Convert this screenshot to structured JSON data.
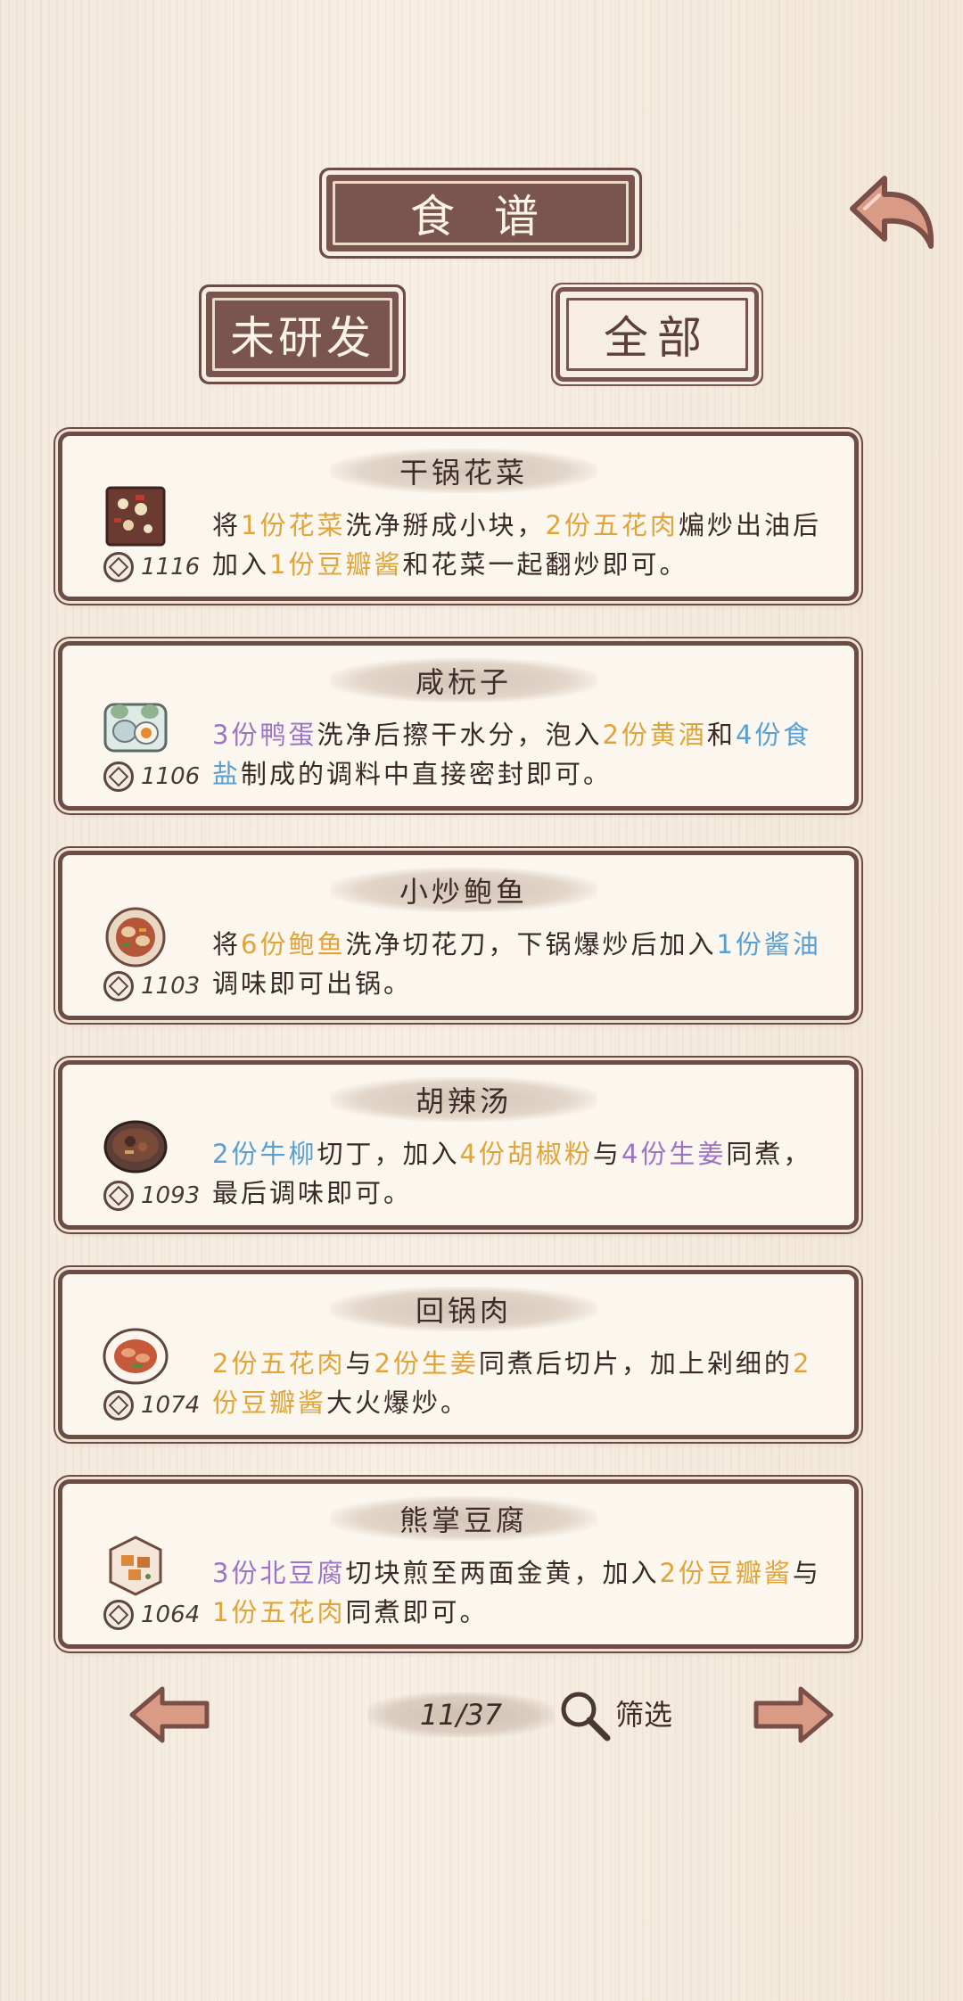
{
  "header": {
    "title": "食 谱",
    "tab_undeveloped": "未研发",
    "tab_all": "全部"
  },
  "recipes": [
    {
      "name": "干锅花菜",
      "price": "1116",
      "dish_icon": "dry-pot-cauliflower-dish-icon",
      "desc": [
        {
          "t": "将",
          "c": ""
        },
        {
          "t": "1份花菜",
          "c": "y"
        },
        {
          "t": "洗净掰成小块，",
          "c": ""
        },
        {
          "t": "2份五花肉",
          "c": "y"
        },
        {
          "t": "煸炒出油后加入",
          "c": ""
        },
        {
          "t": "1份豆瓣酱",
          "c": "y"
        },
        {
          "t": "和花菜一起翻炒即可。",
          "c": ""
        }
      ]
    },
    {
      "name": "咸杬子",
      "price": "1106",
      "dish_icon": "salted-duck-egg-dish-icon",
      "desc": [
        {
          "t": "3份鸭蛋",
          "c": "p"
        },
        {
          "t": "洗净后擦干水分，泡入",
          "c": ""
        },
        {
          "t": "2份黄酒",
          "c": "y"
        },
        {
          "t": "和",
          "c": ""
        },
        {
          "t": "4份食盐",
          "c": "b"
        },
        {
          "t": "制成的调料中直接密封即可。",
          "c": ""
        }
      ]
    },
    {
      "name": "小炒鲍鱼",
      "price": "1103",
      "dish_icon": "stir-fried-abalone-dish-icon",
      "desc": [
        {
          "t": "将",
          "c": ""
        },
        {
          "t": "6份鲍鱼",
          "c": "y"
        },
        {
          "t": "洗净切花刀，下锅爆炒后加入",
          "c": ""
        },
        {
          "t": "1份酱油",
          "c": "b"
        },
        {
          "t": "调味即可出锅。",
          "c": ""
        }
      ]
    },
    {
      "name": "胡辣汤",
      "price": "1093",
      "dish_icon": "spicy-soup-dish-icon",
      "desc": [
        {
          "t": "2份牛柳",
          "c": "b"
        },
        {
          "t": "切丁，加入",
          "c": ""
        },
        {
          "t": "4份胡椒粉",
          "c": "y"
        },
        {
          "t": "与",
          "c": ""
        },
        {
          "t": "4份生姜",
          "c": "p"
        },
        {
          "t": "同煮，最后调味即可。",
          "c": ""
        }
      ]
    },
    {
      "name": "回锅肉",
      "price": "1074",
      "dish_icon": "twice-cooked-pork-dish-icon",
      "desc": [
        {
          "t": "2份五花肉",
          "c": "y"
        },
        {
          "t": "与",
          "c": ""
        },
        {
          "t": "2份生姜",
          "c": "y"
        },
        {
          "t": "同煮后切片，加上剁细的",
          "c": ""
        },
        {
          "t": "2份豆瓣酱",
          "c": "y"
        },
        {
          "t": "大火爆炒。",
          "c": ""
        }
      ]
    },
    {
      "name": "熊掌豆腐",
      "price": "1064",
      "dish_icon": "bear-paw-tofu-dish-icon",
      "desc": [
        {
          "t": "3份北豆腐",
          "c": "p"
        },
        {
          "t": "切块煎至两面金黄，加入",
          "c": ""
        },
        {
          "t": "2份豆瓣酱",
          "c": "y"
        },
        {
          "t": "与",
          "c": ""
        },
        {
          "t": "1份五花肉",
          "c": "y"
        },
        {
          "t": "同煮即可。",
          "c": ""
        }
      ]
    }
  ],
  "pager": {
    "page": "11/37",
    "filter_label": "筛选"
  },
  "colors": {
    "plaque": "#7a5550",
    "highlight_yellow": "#e0a43a",
    "highlight_purple": "#9b74c7",
    "highlight_blue": "#5a9fd4"
  }
}
